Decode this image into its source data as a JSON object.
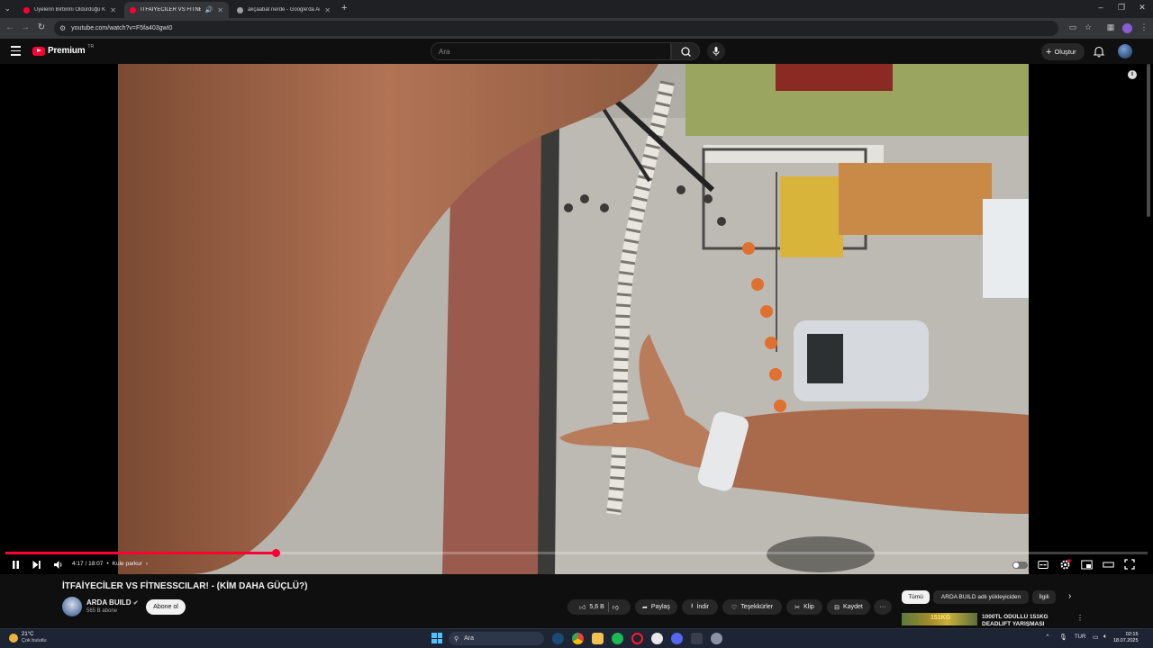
{
  "browser": {
    "tabs": [
      {
        "title": "Üyelerin Birbirini Öldürdüğü Kı",
        "active": false,
        "fav_color": "#ff0033"
      },
      {
        "title": "İTFAİYECİLER VS FİTNESSCI",
        "active": true,
        "fav_color": "#ff0033"
      },
      {
        "title": "akçaabat nerde - Google'da Ara",
        "active": false,
        "fav_color": "#9aa0a6"
      }
    ],
    "new_tab": "+",
    "url": "youtube.com/watch?v=F5fa403gwI0"
  },
  "youtube": {
    "logo_text": "Premium",
    "logo_badge": "TR",
    "search_placeholder": "Ara",
    "create_label": "Oluştur"
  },
  "player": {
    "current_time": "4:17",
    "duration": "18:07",
    "chapter": "Kule parkur",
    "progress_fraction": 0.237,
    "info_icon": "i"
  },
  "video": {
    "title": "İTFAİYECİLER VS FİTNESSCILAR! - (KİM DAHA GÜÇLÜ?)",
    "channel": "ARDA BUILD",
    "subscribers": "565 B abone",
    "subscribe_label": "Abone ol",
    "likes": "5,6 B",
    "share_label": "Paylaş",
    "download_label": "İndir",
    "thanks_label": "Teşekkürler",
    "clip_label": "Klip",
    "save_label": "Kaydet",
    "more_label": "···"
  },
  "sidebar": {
    "chips": [
      "Tümü",
      "ARDA BUILD adlı yükleyiciden",
      "İlgili"
    ],
    "related_title": "1000TL ÖDÜLLÜ 151KG DEADLIFT YARIŞMASI",
    "thumb_text": "151KG"
  },
  "taskbar": {
    "temperature": "21°C",
    "weather": "Çok bulutlu",
    "search_label": "Ara",
    "language": "TUR",
    "time": "02:15",
    "date": "18.07.2025"
  },
  "colors": {
    "accent": "#ff0033",
    "background": "#0f0f0f"
  }
}
